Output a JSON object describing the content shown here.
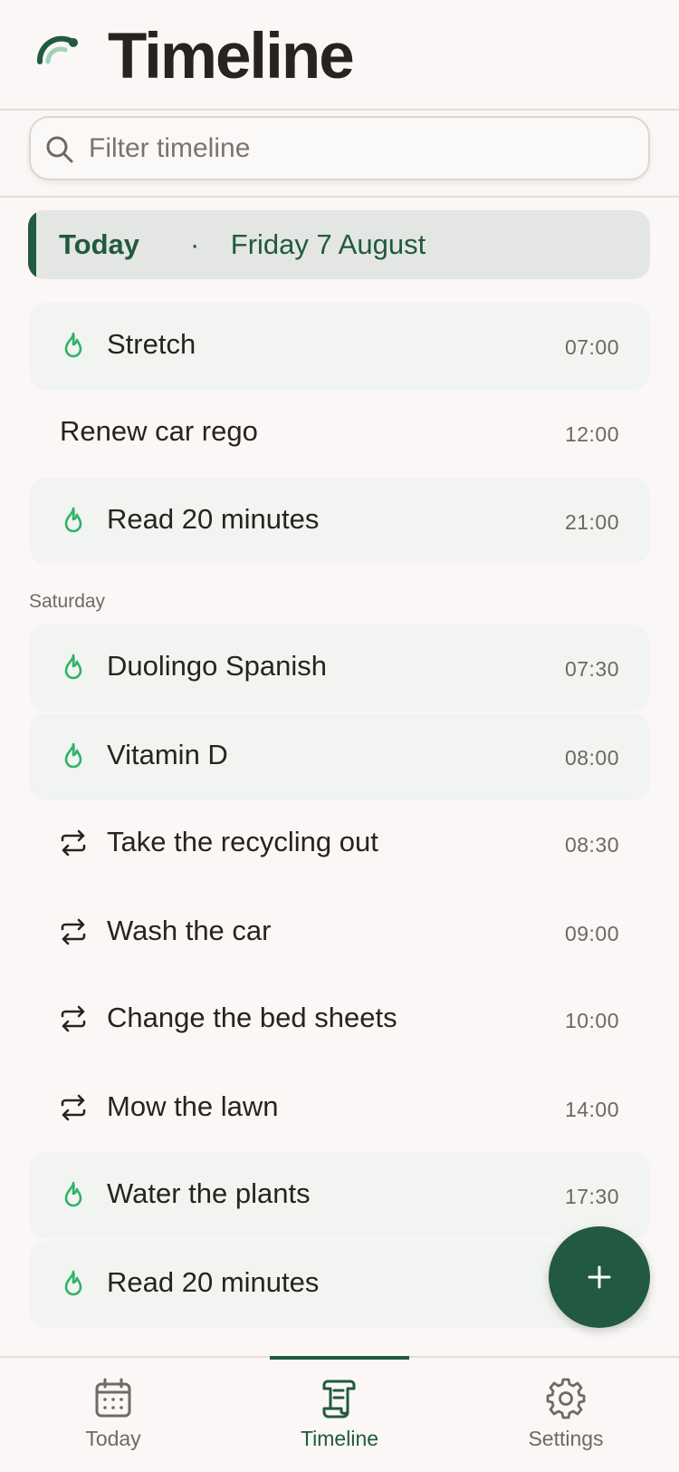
{
  "header": {
    "title": "Timeline",
    "logo_icon": "rainbow-arc-logo"
  },
  "search": {
    "placeholder": "Filter timeline",
    "value": ""
  },
  "today": {
    "label": "Today",
    "separator": "·",
    "date": "Friday 7 August"
  },
  "today_items": [
    {
      "title": "Stretch",
      "time": "07:00",
      "icon": "flame-icon",
      "kind": "habit"
    },
    {
      "title": "Renew car rego",
      "time": "12:00",
      "icon": "",
      "kind": "task"
    },
    {
      "title": "Read 20 minutes",
      "time": "21:00",
      "icon": "flame-icon",
      "kind": "habit"
    }
  ],
  "saturday": {
    "label": "Saturday",
    "items": [
      {
        "title": "Duolingo Spanish",
        "time": "07:30",
        "icon": "flame-icon",
        "kind": "habit"
      },
      {
        "title": "Vitamin D",
        "time": "08:00",
        "icon": "flame-icon",
        "kind": "habit"
      },
      {
        "title": "Take the recycling out",
        "time": "08:30",
        "icon": "repeat-icon",
        "kind": "recurring"
      },
      {
        "title": "Wash the car",
        "time": "09:00",
        "icon": "repeat-icon",
        "kind": "recurring"
      },
      {
        "title": "Change the bed sheets",
        "time": "10:00",
        "icon": "repeat-icon",
        "kind": "recurring"
      },
      {
        "title": "Mow the lawn",
        "time": "14:00",
        "icon": "repeat-icon",
        "kind": "recurring"
      },
      {
        "title": "Water the plants",
        "time": "17:30",
        "icon": "flame-icon",
        "kind": "habit"
      },
      {
        "title": "Read 20 minutes",
        "time": "",
        "icon": "flame-icon",
        "kind": "habit"
      }
    ]
  },
  "fab": {
    "icon": "plus-icon"
  },
  "nav": {
    "items": [
      {
        "label": "Today",
        "icon": "calendar-icon",
        "active": false
      },
      {
        "label": "Timeline",
        "icon": "scroll-icon",
        "active": true
      },
      {
        "label": "Settings",
        "icon": "gear-icon",
        "active": false
      }
    ]
  },
  "colors": {
    "accent": "#215941",
    "flame": "#2fb26a",
    "background": "#faf7f6",
    "habit_row": "#f1f4f1",
    "today_bar": "#e4e6e3"
  }
}
